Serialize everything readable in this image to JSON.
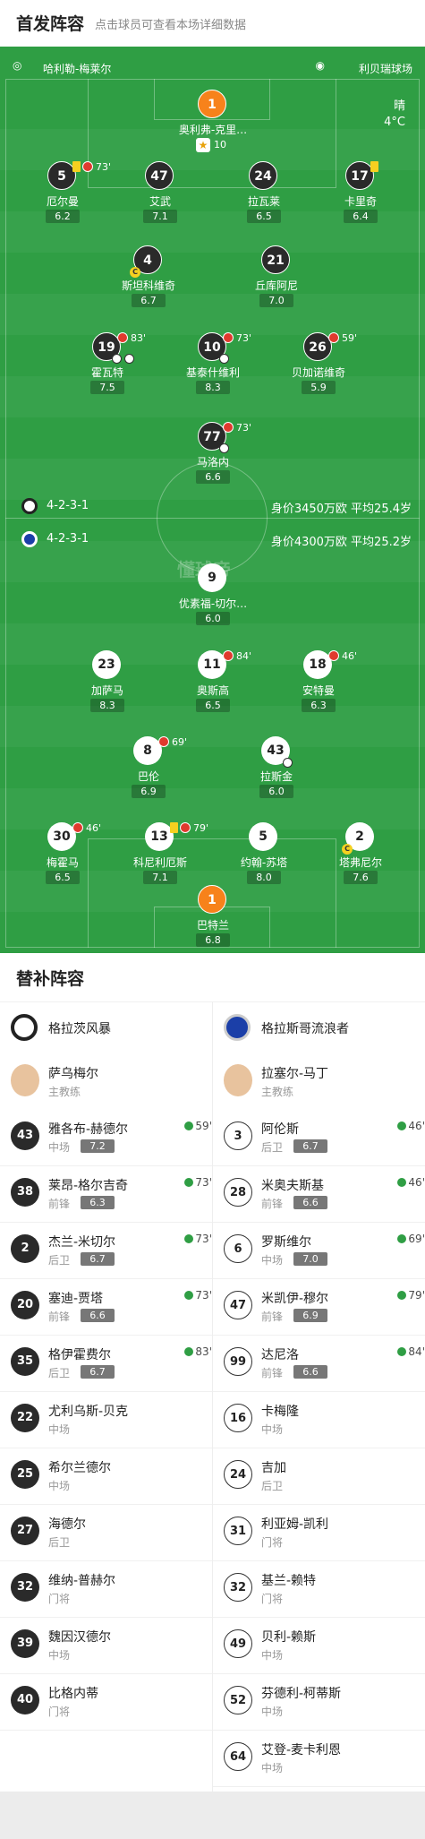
{
  "header": {
    "title": "首发阵容",
    "subtitle": "点击球员可查看本场详细数据"
  },
  "field": {
    "home_team_label": "哈利勒-梅莱尔",
    "away_team_label": "利贝瑞球场",
    "weather": "晴",
    "temperature": "4°C",
    "watermark": "懂球帝",
    "home_formation": "4-2-3-1",
    "away_formation": "4-2-3-1",
    "home_value": "身价3450万欧 平均25.4岁",
    "away_value": "身价4300万欧 平均25.2岁"
  },
  "home_players": [
    {
      "num": "1",
      "name": "奥利弗-克里…",
      "rating": "10",
      "style": "g"
    },
    {
      "num": "5",
      "name": "厄尔曼",
      "rating": "6.2",
      "style": "d",
      "sub": "73'"
    },
    {
      "num": "47",
      "name": "艾武",
      "rating": "7.1",
      "style": "d"
    },
    {
      "num": "24",
      "name": "拉瓦莱",
      "rating": "6.5",
      "style": "d"
    },
    {
      "num": "17",
      "name": "卡里奇",
      "rating": "6.4",
      "style": "d"
    },
    {
      "num": "4",
      "name": "斯坦科维奇",
      "rating": "6.7",
      "style": "d"
    },
    {
      "num": "21",
      "name": "丘库阿尼",
      "rating": "7.0",
      "style": "d"
    },
    {
      "num": "19",
      "name": "霍瓦特",
      "rating": "7.5",
      "style": "d",
      "sub": "83'"
    },
    {
      "num": "10",
      "name": "基泰什维利",
      "rating": "8.3",
      "style": "d",
      "sub": "73'"
    },
    {
      "num": "26",
      "name": "贝加诺维奇",
      "rating": "5.9",
      "style": "d",
      "sub": "59'"
    },
    {
      "num": "77",
      "name": "马洛内",
      "rating": "6.6",
      "style": "d",
      "sub": "73'"
    }
  ],
  "away_players": [
    {
      "num": "9",
      "name": "优素福-切尔…",
      "rating": "6.0",
      "style": "w"
    },
    {
      "num": "23",
      "name": "加萨马",
      "rating": "8.3",
      "style": "w"
    },
    {
      "num": "11",
      "name": "奥斯高",
      "rating": "6.5",
      "style": "w",
      "sub": "84'"
    },
    {
      "num": "18",
      "name": "安特曼",
      "rating": "6.3",
      "style": "w",
      "sub": "46'"
    },
    {
      "num": "8",
      "name": "巴伦",
      "rating": "6.9",
      "style": "w",
      "sub": "69'"
    },
    {
      "num": "43",
      "name": "拉斯金",
      "rating": "6.0",
      "style": "w"
    },
    {
      "num": "30",
      "name": "梅霍马",
      "rating": "6.5",
      "style": "w",
      "sub": "46'"
    },
    {
      "num": "13",
      "name": "科尼利厄斯",
      "rating": "7.1",
      "style": "w",
      "sub": "79'"
    },
    {
      "num": "5",
      "name": "约翰-苏塔",
      "rating": "8.0",
      "style": "w"
    },
    {
      "num": "2",
      "name": "塔弗尼尔",
      "rating": "7.6",
      "style": "w"
    },
    {
      "num": "1",
      "name": "巴特兰",
      "rating": "6.8",
      "style": "g"
    }
  ],
  "subs_title": "替补阵容",
  "home_team": {
    "name": "格拉茨风暴",
    "coach": "萨乌梅尔",
    "coach_role": "主教练"
  },
  "away_team": {
    "name": "格拉斯哥流浪者",
    "coach": "拉塞尔-马丁",
    "coach_role": "主教练"
  },
  "home_subs": [
    {
      "num": "43",
      "name": "雅各布-赫德尔",
      "pos": "中场",
      "rating": "7.2",
      "sub": "59'"
    },
    {
      "num": "38",
      "name": "莱昂-格尔吉奇",
      "pos": "前锋",
      "rating": "6.3",
      "sub": "73'"
    },
    {
      "num": "2",
      "name": "杰兰-米切尔",
      "pos": "后卫",
      "rating": "6.7",
      "sub": "73'"
    },
    {
      "num": "20",
      "name": "塞迪-贾塔",
      "pos": "前锋",
      "rating": "6.6",
      "sub": "73'"
    },
    {
      "num": "35",
      "name": "格伊霍费尔",
      "pos": "后卫",
      "rating": "6.7",
      "sub": "83'"
    },
    {
      "num": "22",
      "name": "尤利乌斯-贝克",
      "pos": "中场"
    },
    {
      "num": "25",
      "name": "希尔兰德尔",
      "pos": "中场"
    },
    {
      "num": "27",
      "name": "海德尔",
      "pos": "后卫"
    },
    {
      "num": "32",
      "name": "维纳-普赫尔",
      "pos": "门将"
    },
    {
      "num": "39",
      "name": "魏因汉德尔",
      "pos": "中场"
    },
    {
      "num": "40",
      "name": "比格内蒂",
      "pos": "门将"
    }
  ],
  "away_subs": [
    {
      "num": "3",
      "name": "阿伦斯",
      "pos": "后卫",
      "rating": "6.7",
      "sub": "46'"
    },
    {
      "num": "28",
      "name": "米奥夫斯基",
      "pos": "前锋",
      "rating": "6.6",
      "sub": "46'"
    },
    {
      "num": "6",
      "name": "罗斯维尔",
      "pos": "中场",
      "rating": "7.0",
      "sub": "69'"
    },
    {
      "num": "47",
      "name": "米凯伊-穆尔",
      "pos": "前锋",
      "rating": "6.9",
      "sub": "79'"
    },
    {
      "num": "99",
      "name": "达尼洛",
      "pos": "前锋",
      "rating": "6.6",
      "sub": "84'"
    },
    {
      "num": "16",
      "name": "卡梅隆",
      "pos": "中场"
    },
    {
      "num": "24",
      "name": "吉加",
      "pos": "后卫"
    },
    {
      "num": "31",
      "name": "利亚姆-凯利",
      "pos": "门将"
    },
    {
      "num": "32",
      "name": "基兰-赖特",
      "pos": "门将"
    },
    {
      "num": "49",
      "name": "贝利-赖斯",
      "pos": "中场"
    },
    {
      "num": "52",
      "name": "芬德利-柯蒂斯",
      "pos": "中场"
    },
    {
      "num": "64",
      "name": "艾登-麦卡利恩",
      "pos": "中场"
    }
  ],
  "colors": {
    "pitch": "#2f9e44",
    "keeper": "#f7821b",
    "yellow_card": "#f5d020",
    "sub_off": "#e03a2e",
    "sub_on": "#2f9e44"
  }
}
